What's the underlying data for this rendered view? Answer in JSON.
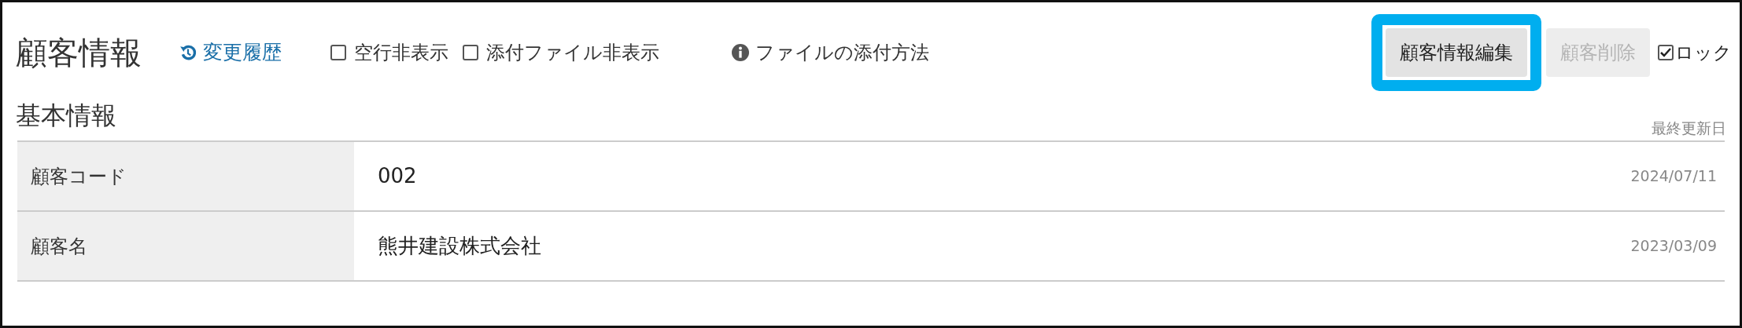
{
  "header": {
    "title": "顧客情報",
    "history_link": "変更履歴",
    "options": [
      {
        "label": "空行非表示",
        "checked": false
      },
      {
        "label": "添付ファイル非表示",
        "checked": false
      }
    ],
    "help_link": "ファイルの添付方法"
  },
  "actions": [
    {
      "label": "顧客情報編集",
      "disabled": false,
      "highlighted": true
    },
    {
      "label": "顧客削除",
      "disabled": true,
      "highlighted": false
    }
  ],
  "lock": {
    "label": "ロック",
    "checked": true
  },
  "section": {
    "title": "基本情報",
    "updated_heading": "最終更新日",
    "rows": [
      {
        "label": "顧客コード",
        "value": "002",
        "updated": "2024/07/11"
      },
      {
        "label": "顧客名",
        "value": "熊井建設株式会社",
        "updated": "2023/03/09"
      }
    ]
  }
}
